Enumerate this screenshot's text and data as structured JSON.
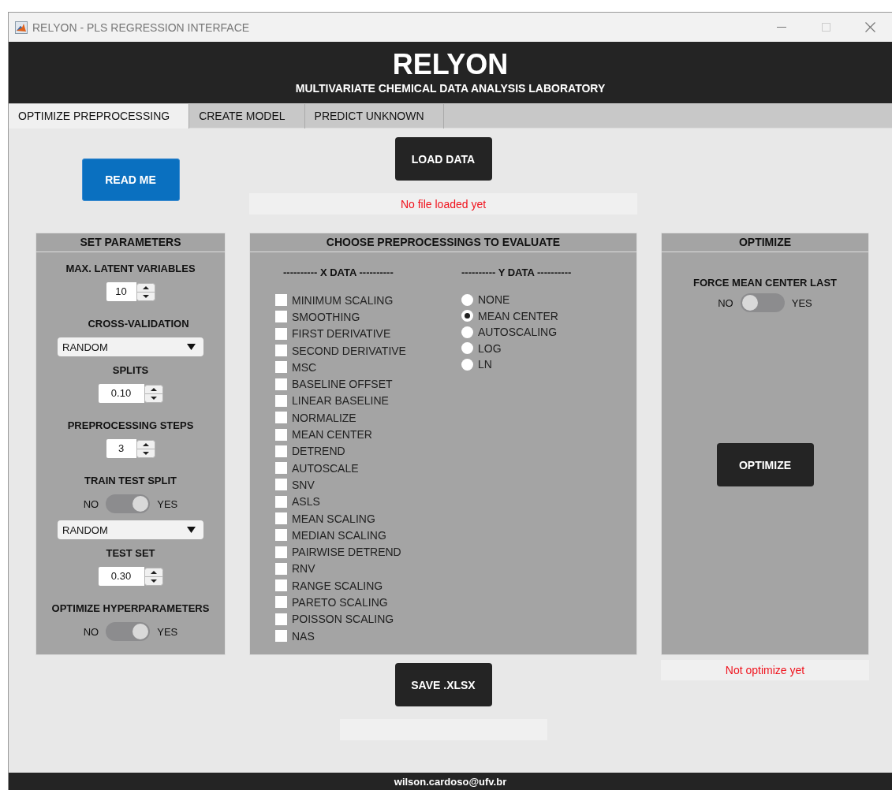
{
  "window": {
    "title": "RELYON - PLS REGRESSION INTERFACE"
  },
  "header": {
    "title": "RELYON",
    "subtitle": "MULTIVARIATE CHEMICAL DATA ANALYSIS LABORATORY"
  },
  "tabs": [
    {
      "label": "OPTIMIZE PREPROCESSING",
      "selected": true
    },
    {
      "label": "CREATE MODEL",
      "selected": false
    },
    {
      "label": "PREDICT UNKNOWN",
      "selected": false
    }
  ],
  "read_me_button": "READ ME",
  "load_data_button": "LOAD DATA",
  "file_status": "No file loaded yet",
  "set_parameters": {
    "title": "SET PARAMETERS",
    "controls": [
      {
        "kind": "spinner",
        "label": "MAX. LATENT VARIABLES",
        "value": "10"
      },
      {
        "kind": "dropdown",
        "label": "CROSS-VALIDATION",
        "value": "RANDOM"
      },
      {
        "kind": "spinner",
        "label": "SPLITS",
        "value": "0.10"
      },
      {
        "kind": "spinner",
        "label": "PREPROCESSING STEPS",
        "value": "3"
      },
      {
        "kind": "switch",
        "label": "TRAIN TEST SPLIT",
        "off_label": "NO",
        "on_label": "YES",
        "on": true
      },
      {
        "kind": "dropdown",
        "value": "RANDOM"
      },
      {
        "kind": "spinner",
        "label": "TEST SET",
        "value": "0.30"
      },
      {
        "kind": "switch",
        "label": "OPTIMIZE HYPERPARAMETERS",
        "off_label": "NO",
        "on_label": "YES",
        "on": true
      }
    ]
  },
  "preprocessing": {
    "title": "CHOOSE PREPROCESSINGS TO EVALUATE",
    "x_heading": "---------- X DATA ----------",
    "x_options": [
      {
        "label": "MINIMUM SCALING",
        "checked": false
      },
      {
        "label": "SMOOTHING",
        "checked": false
      },
      {
        "label": "FIRST DERIVATIVE",
        "checked": false
      },
      {
        "label": "SECOND DERIVATIVE",
        "checked": false
      },
      {
        "label": "MSC",
        "checked": false
      },
      {
        "label": "BASELINE OFFSET",
        "checked": false
      },
      {
        "label": "LINEAR BASELINE",
        "checked": false
      },
      {
        "label": "NORMALIZE",
        "checked": false
      },
      {
        "label": "MEAN CENTER",
        "checked": false
      },
      {
        "label": "DETREND",
        "checked": false
      },
      {
        "label": "AUTOSCALE",
        "checked": false
      },
      {
        "label": "SNV",
        "checked": false
      },
      {
        "label": "ASLS",
        "checked": false
      },
      {
        "label": "MEAN SCALING",
        "checked": false
      },
      {
        "label": "MEDIAN SCALING",
        "checked": false
      },
      {
        "label": "PAIRWISE DETREND",
        "checked": false
      },
      {
        "label": "RNV",
        "checked": false
      },
      {
        "label": "RANGE SCALING",
        "checked": false
      },
      {
        "label": "PARETO SCALING",
        "checked": false
      },
      {
        "label": "POISSON SCALING",
        "checked": false
      },
      {
        "label": "NAS",
        "checked": false
      }
    ],
    "y_heading": "---------- Y DATA ----------",
    "y_options": [
      {
        "label": "NONE",
        "selected": false
      },
      {
        "label": "MEAN CENTER",
        "selected": true
      },
      {
        "label": "AUTOSCALING",
        "selected": false
      },
      {
        "label": "LOG",
        "selected": false
      },
      {
        "label": "LN",
        "selected": false
      }
    ]
  },
  "optimize": {
    "title": "OPTIMIZE",
    "switch": {
      "label": "FORCE MEAN CENTER LAST",
      "off_label": "NO",
      "on_label": "YES",
      "on": false
    },
    "button": "OPTIMIZE",
    "status": "Not optimize yet"
  },
  "save_button": "SAVE .XLSX",
  "footer": "wilson.cardoso@ufv.br"
}
